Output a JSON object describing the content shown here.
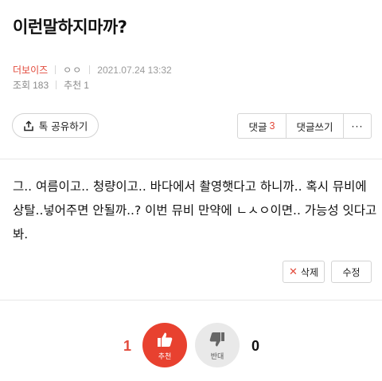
{
  "post": {
    "title": "이런말하지마까?",
    "board": "더보이즈",
    "author": "ㅇㅇ",
    "date": "2021.07.24 13:32",
    "views_label": "조회",
    "views": "183",
    "recommend_label": "추천",
    "recommend": "1",
    "body": "그.. 여름이고.. 청량이고.. 바다에서 촬영햇다고 하니까.. 혹시 뮤비에 상탈..넣어주면 안될까..? 이번 뮤비 만약에 ㄴㅅㅇ이면.. 가능성 잇다고 봐."
  },
  "toolbar": {
    "share_label": "톡 공유하기",
    "comment_label": "댓글",
    "comment_count": "3",
    "write_comment_label": "댓글쓰기",
    "more_label": "···"
  },
  "actions": {
    "delete_label": "삭제",
    "edit_label": "수정"
  },
  "votes": {
    "up_count": "1",
    "up_label": "추천",
    "down_count": "0",
    "down_label": "반대"
  },
  "colors": {
    "accent": "#e24a3b",
    "upvote_bg": "#e8412f",
    "downvote_bg": "#e9e9e9"
  }
}
